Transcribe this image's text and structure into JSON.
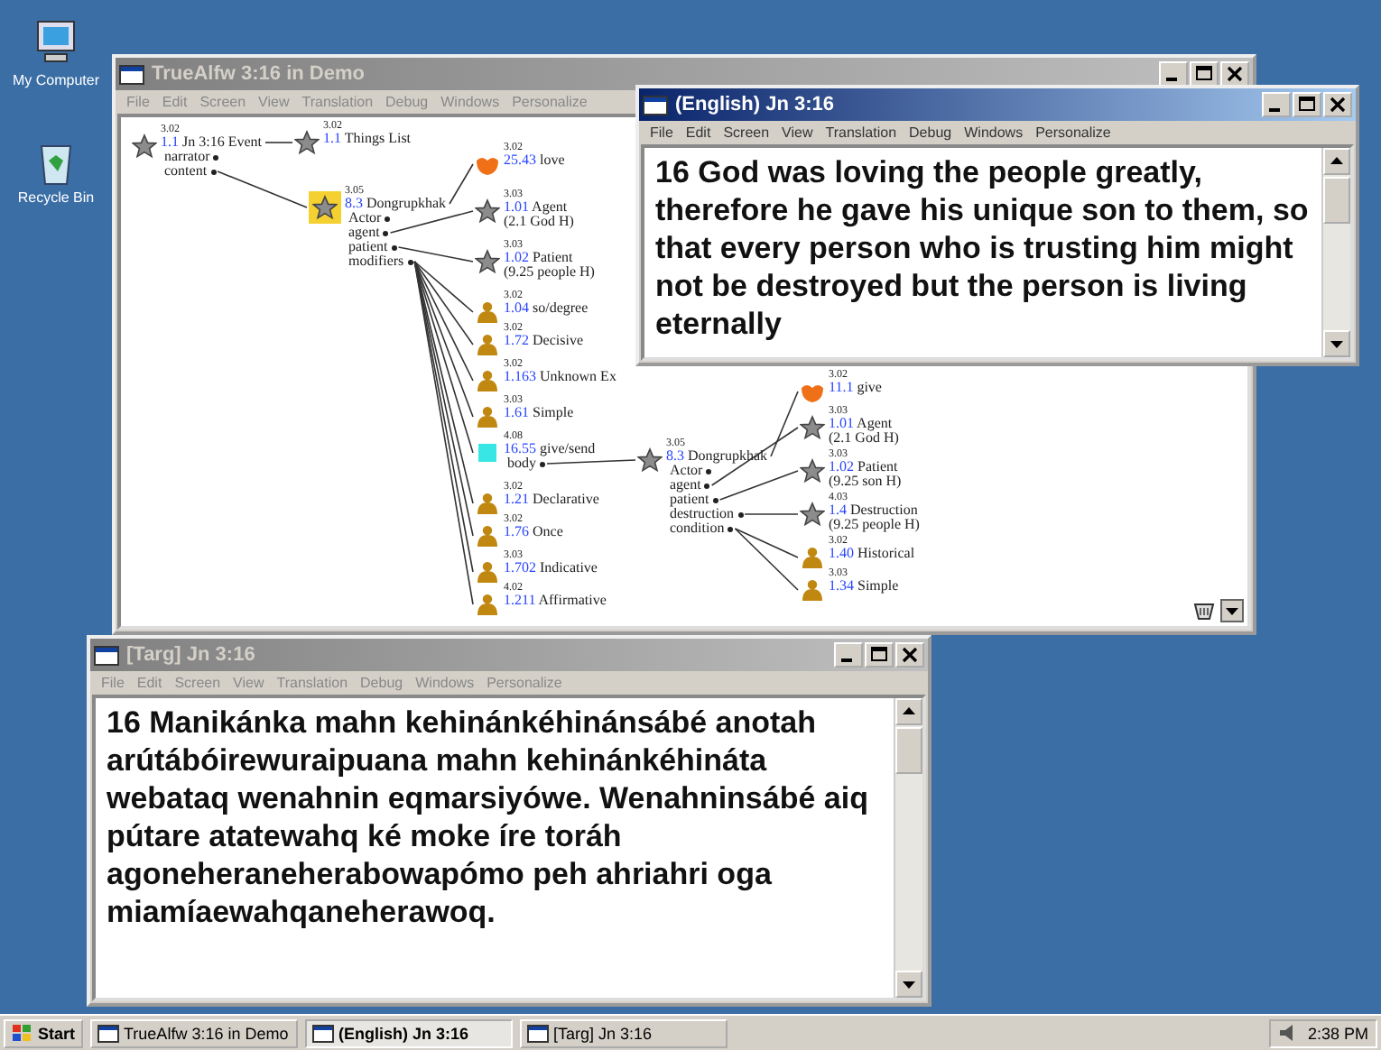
{
  "desktop": {
    "icons": [
      {
        "kind": "computer",
        "label": "My Computer"
      },
      {
        "kind": "bin",
        "label": "Recycle Bin"
      }
    ]
  },
  "main_window": {
    "title": "TrueAlfw 3:16 in Demo",
    "active": false,
    "menu": [
      "File",
      "Edit",
      "Screen",
      "View",
      "Translation",
      "Debug",
      "Windows",
      "Personalize"
    ],
    "tree": [
      {
        "kind": "star",
        "selected": false,
        "tag": "3.02",
        "code": "1.1",
        "label": "Jn 3:16 Event",
        "roles": [
          "narrator",
          "content"
        ],
        "children": [
          {
            "kind": "star",
            "selected": false,
            "tag": "3.02",
            "code": "1.1",
            "label": "Things List"
          },
          {
            "kind": "star",
            "selected": true,
            "tag": "3.05",
            "code": "8.3",
            "label": "Dongrupkhak",
            "roles": [
              "Actor",
              "agent",
              "patient",
              "modifiers"
            ],
            "children": [
              {
                "kind": "orange",
                "selected": false,
                "tag": "3.02",
                "code": "25.43",
                "label": "love"
              },
              {
                "kind": "star",
                "selected": false,
                "tag": "3.03",
                "code": "1.01",
                "label": "Agent",
                "note": "(2.1 God H)"
              },
              {
                "kind": "star",
                "selected": false,
                "tag": "3.03",
                "code": "1.02",
                "label": "Patient",
                "note": "(9.25 people H)"
              },
              {
                "kind": "gold",
                "selected": false,
                "tag": "3.02",
                "code": "1.04",
                "label": "so/degree"
              },
              {
                "kind": "gold",
                "selected": false,
                "tag": "3.02",
                "code": "1.72",
                "label": "Decisive"
              },
              {
                "kind": "gold",
                "selected": false,
                "tag": "3.02",
                "code": "1.163",
                "label": "Unknown Ex"
              },
              {
                "kind": "gold",
                "selected": false,
                "tag": "3.03",
                "code": "1.61",
                "label": "Simple"
              },
              {
                "kind": "cyan",
                "selected": false,
                "tag": "4.08",
                "code": "16.55",
                "label": "give/send",
                "roles": [
                  "body"
                ],
                "children": [
                  {
                    "kind": "star",
                    "selected": false,
                    "tag": "3.05",
                    "code": "8.3",
                    "label": "Dongrupkhak",
                    "roles": [
                      "Actor",
                      "agent",
                      "patient",
                      "destruction",
                      "condition"
                    ],
                    "children": [
                      {
                        "kind": "orange",
                        "selected": false,
                        "tag": "3.02",
                        "code": "11.1",
                        "label": "give"
                      },
                      {
                        "kind": "star",
                        "selected": false,
                        "tag": "3.03",
                        "code": "1.01",
                        "label": "Agent",
                        "note": "(2.1 God H)"
                      },
                      {
                        "kind": "star",
                        "selected": false,
                        "tag": "3.03",
                        "code": "1.02",
                        "label": "Patient",
                        "note": "(9.25 son H)"
                      },
                      {
                        "kind": "star",
                        "selected": false,
                        "tag": "4.03",
                        "code": "1.4",
                        "label": "Destruction",
                        "note": "(9.25 people H)"
                      },
                      {
                        "kind": "gold",
                        "selected": false,
                        "tag": "3.02",
                        "code": "1.40",
                        "label": "Historical"
                      },
                      {
                        "kind": "gold",
                        "selected": false,
                        "tag": "3.03",
                        "code": "1.34",
                        "label": "Simple"
                      }
                    ]
                  }
                ]
              },
              {
                "kind": "gold",
                "selected": false,
                "tag": "3.02",
                "code": "1.21",
                "label": "Declarative"
              },
              {
                "kind": "gold",
                "selected": false,
                "tag": "3.02",
                "code": "1.76",
                "label": "Once"
              },
              {
                "kind": "gold",
                "selected": false,
                "tag": "3.03",
                "code": "1.702",
                "label": "Indicative"
              },
              {
                "kind": "gold",
                "selected": false,
                "tag": "4.02",
                "code": "1.211",
                "label": "Affirmative"
              }
            ]
          }
        ]
      }
    ]
  },
  "english_window": {
    "title": "(English) Jn 3:16",
    "active": true,
    "menu": [
      "File",
      "Edit",
      "Screen",
      "View",
      "Translation",
      "Debug",
      "Windows",
      "Personalize"
    ],
    "text": "16 God was loving the people greatly, therefore he gave his unique son to them, so that every person who is trusting him might not be destroyed but the person is living eternally"
  },
  "target_window": {
    "title": "[Targ] Jn 3:16",
    "active": false,
    "menu": [
      "File",
      "Edit",
      "Screen",
      "View",
      "Translation",
      "Debug",
      "Windows",
      "Personalize"
    ],
    "text": "16 Manikánka mahn kehinánkéhinánsábé anotah arútábóirewuraipuana mahn kehinánkéhináta webataq wenahnin eqmarsiyówe. Wenahninsábé aiq pútare atatewahq ké moke íre toráh agoneheraneherabowapómo peh ahriahri oga miamíaewahqaneherawoq."
  },
  "taskbar": {
    "start": "Start",
    "tasks": [
      {
        "label": "TrueAlfw 3:16 in Demo",
        "selected": false
      },
      {
        "label": "(English) Jn 3:16",
        "selected": true
      },
      {
        "label": "[Targ] Jn 3:16",
        "selected": false
      }
    ],
    "clock": "2:38 PM"
  }
}
